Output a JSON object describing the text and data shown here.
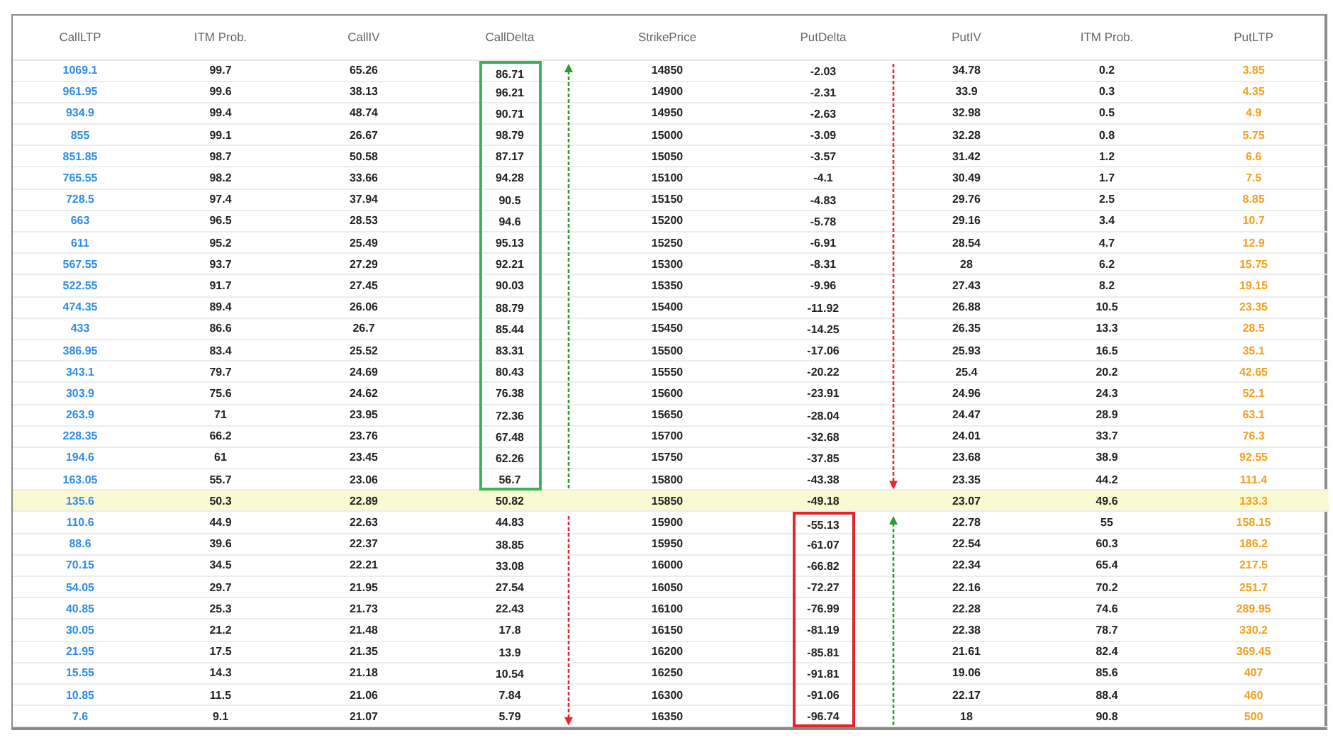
{
  "columns": [
    {
      "label": "CallLTP",
      "kind": "call_ltp"
    },
    {
      "label": "ITM Prob.",
      "kind": "plain"
    },
    {
      "label": "CallIV",
      "kind": "plain"
    },
    {
      "label": "CallDelta",
      "kind": "call_delta"
    },
    {
      "label": "StrikePrice",
      "kind": "plain"
    },
    {
      "label": "PutDelta",
      "kind": "put_delta"
    },
    {
      "label": "PutIV",
      "kind": "plain"
    },
    {
      "label": "ITM Prob.",
      "kind": "plain"
    },
    {
      "label": "PutLTP",
      "kind": "put_ltp"
    }
  ],
  "rows": [
    {
      "cells": [
        "1069.1",
        "99.7",
        "65.26",
        "86.71",
        "14850",
        "-2.03",
        "34.78",
        "0.2",
        "3.85"
      ],
      "atm": false,
      "call_boxed": true,
      "put_boxed": false
    },
    {
      "cells": [
        "961.95",
        "99.6",
        "38.13",
        "96.21",
        "14900",
        "-2.31",
        "33.9",
        "0.3",
        "4.35"
      ],
      "atm": false,
      "call_boxed": true,
      "put_boxed": false
    },
    {
      "cells": [
        "934.9",
        "99.4",
        "48.74",
        "90.71",
        "14950",
        "-2.63",
        "32.98",
        "0.5",
        "4.9"
      ],
      "atm": false,
      "call_boxed": true,
      "put_boxed": false
    },
    {
      "cells": [
        "855",
        "99.1",
        "26.67",
        "98.79",
        "15000",
        "-3.09",
        "32.28",
        "0.8",
        "5.75"
      ],
      "atm": false,
      "call_boxed": true,
      "put_boxed": false
    },
    {
      "cells": [
        "851.85",
        "98.7",
        "50.58",
        "87.17",
        "15050",
        "-3.57",
        "31.42",
        "1.2",
        "6.6"
      ],
      "atm": false,
      "call_boxed": true,
      "put_boxed": false
    },
    {
      "cells": [
        "765.55",
        "98.2",
        "33.66",
        "94.28",
        "15100",
        "-4.1",
        "30.49",
        "1.7",
        "7.5"
      ],
      "atm": false,
      "call_boxed": true,
      "put_boxed": false
    },
    {
      "cells": [
        "728.5",
        "97.4",
        "37.94",
        "90.5",
        "15150",
        "-4.83",
        "29.76",
        "2.5",
        "8.85"
      ],
      "atm": false,
      "call_boxed": true,
      "put_boxed": false
    },
    {
      "cells": [
        "663",
        "96.5",
        "28.53",
        "94.6",
        "15200",
        "-5.78",
        "29.16",
        "3.4",
        "10.7"
      ],
      "atm": false,
      "call_boxed": true,
      "put_boxed": false
    },
    {
      "cells": [
        "611",
        "95.2",
        "25.49",
        "95.13",
        "15250",
        "-6.91",
        "28.54",
        "4.7",
        "12.9"
      ],
      "atm": false,
      "call_boxed": true,
      "put_boxed": false
    },
    {
      "cells": [
        "567.55",
        "93.7",
        "27.29",
        "92.21",
        "15300",
        "-8.31",
        "28",
        "6.2",
        "15.75"
      ],
      "atm": false,
      "call_boxed": true,
      "put_boxed": false
    },
    {
      "cells": [
        "522.55",
        "91.7",
        "27.45",
        "90.03",
        "15350",
        "-9.96",
        "27.43",
        "8.2",
        "19.15"
      ],
      "atm": false,
      "call_boxed": true,
      "put_boxed": false
    },
    {
      "cells": [
        "474.35",
        "89.4",
        "26.06",
        "88.79",
        "15400",
        "-11.92",
        "26.88",
        "10.5",
        "23.35"
      ],
      "atm": false,
      "call_boxed": true,
      "put_boxed": false
    },
    {
      "cells": [
        "433",
        "86.6",
        "26.7",
        "85.44",
        "15450",
        "-14.25",
        "26.35",
        "13.3",
        "28.5"
      ],
      "atm": false,
      "call_boxed": true,
      "put_boxed": false
    },
    {
      "cells": [
        "386.95",
        "83.4",
        "25.52",
        "83.31",
        "15500",
        "-17.06",
        "25.93",
        "16.5",
        "35.1"
      ],
      "atm": false,
      "call_boxed": true,
      "put_boxed": false
    },
    {
      "cells": [
        "343.1",
        "79.7",
        "24.69",
        "80.43",
        "15550",
        "-20.22",
        "25.4",
        "20.2",
        "42.65"
      ],
      "atm": false,
      "call_boxed": true,
      "put_boxed": false
    },
    {
      "cells": [
        "303.9",
        "75.6",
        "24.62",
        "76.38",
        "15600",
        "-23.91",
        "24.96",
        "24.3",
        "52.1"
      ],
      "atm": false,
      "call_boxed": true,
      "put_boxed": false
    },
    {
      "cells": [
        "263.9",
        "71",
        "23.95",
        "72.36",
        "15650",
        "-28.04",
        "24.47",
        "28.9",
        "63.1"
      ],
      "atm": false,
      "call_boxed": true,
      "put_boxed": false
    },
    {
      "cells": [
        "228.35",
        "66.2",
        "23.76",
        "67.48",
        "15700",
        "-32.68",
        "24.01",
        "33.7",
        "76.3"
      ],
      "atm": false,
      "call_boxed": true,
      "put_boxed": false
    },
    {
      "cells": [
        "194.6",
        "61",
        "23.45",
        "62.26",
        "15750",
        "-37.85",
        "23.68",
        "38.9",
        "92.55"
      ],
      "atm": false,
      "call_boxed": true,
      "put_boxed": false
    },
    {
      "cells": [
        "163.05",
        "55.7",
        "23.06",
        "56.7",
        "15800",
        "-43.38",
        "23.35",
        "44.2",
        "111.4"
      ],
      "atm": false,
      "call_boxed": true,
      "put_boxed": false
    },
    {
      "cells": [
        "135.6",
        "50.3",
        "22.89",
        "50.82",
        "15850",
        "-49.18",
        "23.07",
        "49.6",
        "133.3"
      ],
      "atm": true,
      "call_boxed": false,
      "put_boxed": false
    },
    {
      "cells": [
        "110.6",
        "44.9",
        "22.63",
        "44.83",
        "15900",
        "-55.13",
        "22.78",
        "55",
        "158.15"
      ],
      "atm": false,
      "call_boxed": false,
      "put_boxed": true
    },
    {
      "cells": [
        "88.6",
        "39.6",
        "22.37",
        "38.85",
        "15950",
        "-61.07",
        "22.54",
        "60.3",
        "186.2"
      ],
      "atm": false,
      "call_boxed": false,
      "put_boxed": true
    },
    {
      "cells": [
        "70.15",
        "34.5",
        "22.21",
        "33.08",
        "16000",
        "-66.82",
        "22.34",
        "65.4",
        "217.5"
      ],
      "atm": false,
      "call_boxed": false,
      "put_boxed": true
    },
    {
      "cells": [
        "54.05",
        "29.7",
        "21.95",
        "27.54",
        "16050",
        "-72.27",
        "22.16",
        "70.2",
        "251.7"
      ],
      "atm": false,
      "call_boxed": false,
      "put_boxed": true
    },
    {
      "cells": [
        "40.85",
        "25.3",
        "21.73",
        "22.43",
        "16100",
        "-76.99",
        "22.28",
        "74.6",
        "289.95"
      ],
      "atm": false,
      "call_boxed": false,
      "put_boxed": true
    },
    {
      "cells": [
        "30.05",
        "21.2",
        "21.48",
        "17.8",
        "16150",
        "-81.19",
        "22.38",
        "78.7",
        "330.2"
      ],
      "atm": false,
      "call_boxed": false,
      "put_boxed": true
    },
    {
      "cells": [
        "21.95",
        "17.5",
        "21.35",
        "13.9",
        "16200",
        "-85.81",
        "21.61",
        "82.4",
        "369.45"
      ],
      "atm": false,
      "call_boxed": false,
      "put_boxed": true
    },
    {
      "cells": [
        "15.55",
        "14.3",
        "21.18",
        "10.54",
        "16250",
        "-91.81",
        "19.06",
        "85.6",
        "407"
      ],
      "atm": false,
      "call_boxed": false,
      "put_boxed": true
    },
    {
      "cells": [
        "10.85",
        "11.5",
        "21.06",
        "7.84",
        "16300",
        "-91.06",
        "22.17",
        "88.4",
        "460"
      ],
      "atm": false,
      "call_boxed": false,
      "put_boxed": true
    },
    {
      "cells": [
        "7.6",
        "9.1",
        "21.07",
        "5.79",
        "16350",
        "-96.74",
        "18",
        "90.8",
        "500"
      ],
      "atm": false,
      "call_boxed": false,
      "put_boxed": true
    }
  ]
}
